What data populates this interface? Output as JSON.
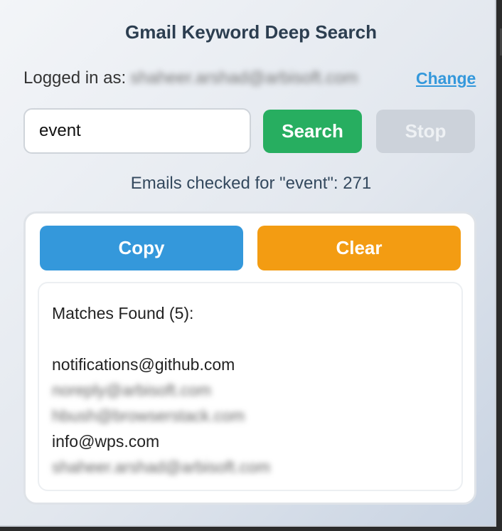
{
  "header": {
    "title": "Gmail Keyword Deep Search"
  },
  "account": {
    "label": "Logged in as:",
    "email": "shaheer.arshad@arbisoft.com",
    "change_label": "Change"
  },
  "search": {
    "value": "event",
    "search_label": "Search",
    "stop_label": "Stop"
  },
  "status": {
    "text": "Emails checked for \"event\": 271"
  },
  "actions": {
    "copy_label": "Copy",
    "clear_label": "Clear"
  },
  "results": {
    "heading": "Matches Found (5):",
    "items": [
      {
        "email": "notifications@github.com",
        "blurred": false
      },
      {
        "email": "noreply@arbisoft.com",
        "blurred": true
      },
      {
        "email": "hbush@browserstack.com",
        "blurred": true
      },
      {
        "email": "info@wps.com",
        "blurred": false
      },
      {
        "email": "shaheer.arshad@arbisoft.com",
        "blurred": true
      }
    ]
  },
  "colors": {
    "search": "#27ae60",
    "stop_disabled": "#ccd2da",
    "copy": "#3498db",
    "clear": "#f39c12",
    "link": "#3498db",
    "title": "#2c3e50"
  }
}
